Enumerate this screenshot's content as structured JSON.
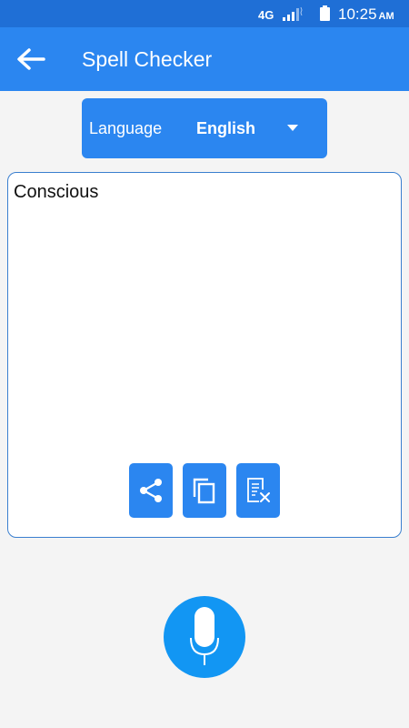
{
  "status_bar": {
    "network": "4G",
    "time": "10:25",
    "ampm": "AM"
  },
  "app_bar": {
    "title": "Spell Checker",
    "back_icon": "arrow-left-icon"
  },
  "language": {
    "label": "Language",
    "value": "English",
    "dropdown_icon": "caret-down-icon"
  },
  "editor": {
    "text": "Conscious"
  },
  "actions": {
    "share_icon": "share-icon",
    "copy_icon": "copy-icon",
    "clear_icon": "clear-text-icon"
  },
  "mic": {
    "icon": "microphone-icon"
  },
  "colors": {
    "status_bar": "#1f6fd6",
    "primary": "#2b86f0",
    "mic": "#1296f3",
    "background": "#f4f4f4"
  }
}
